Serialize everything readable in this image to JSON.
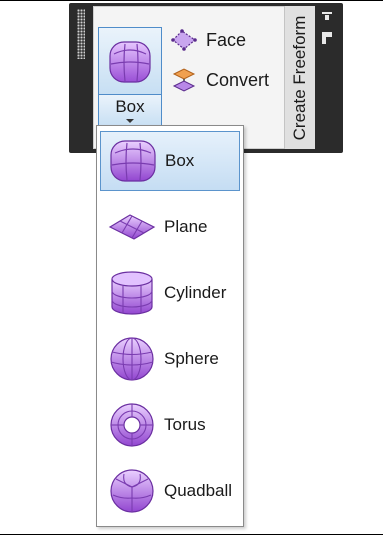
{
  "panel": {
    "title": "Create Freeform",
    "split_button": {
      "label": "Box",
      "icon": "box-primitive-icon"
    },
    "commands": [
      {
        "label": "Face",
        "icon": "face-icon"
      },
      {
        "label": "Convert",
        "icon": "convert-icon"
      }
    ],
    "pin_icon": "pin-icon",
    "launcher_icon": "dialog-launcher-icon"
  },
  "dropdown": {
    "selected": "Box",
    "items": [
      {
        "label": "Box",
        "icon": "box-primitive-icon"
      },
      {
        "label": "Plane",
        "icon": "plane-primitive-icon"
      },
      {
        "label": "Cylinder",
        "icon": "cylinder-primitive-icon"
      },
      {
        "label": "Sphere",
        "icon": "sphere-primitive-icon"
      },
      {
        "label": "Torus",
        "icon": "torus-primitive-icon"
      },
      {
        "label": "Quadball",
        "icon": "quadball-primitive-icon"
      }
    ]
  },
  "colors": {
    "accent_purple": "#9b59d0",
    "highlight_blue": "#c5ddf3",
    "panel_dark": "#2b2b2b"
  }
}
